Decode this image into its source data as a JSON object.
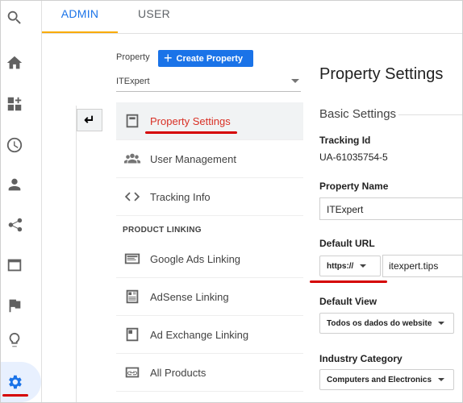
{
  "colors": {
    "accent": "#1a73e8",
    "highlight": "#d93025",
    "annotation": "#d50000",
    "tab_indicator": "#f9ab00"
  },
  "rail": {
    "icons": [
      "search-icon",
      "home-icon",
      "customization-icon",
      "clock-icon",
      "person-icon",
      "acquisition-icon",
      "behavior-icon",
      "flag-icon",
      "lightbulb-icon",
      "gear-icon"
    ]
  },
  "tabs": [
    {
      "label": "ADMIN"
    },
    {
      "label": "USER"
    }
  ],
  "property": {
    "label": "Property",
    "create_button": "Create Property",
    "selected": "ITExpert"
  },
  "nav": {
    "items": [
      {
        "label": "Property Settings",
        "icon": "page-icon"
      },
      {
        "label": "User Management",
        "icon": "people-icon"
      },
      {
        "label": "Tracking Info",
        "icon": "code-icon"
      }
    ],
    "section": "PRODUCT LINKING",
    "linking": [
      {
        "label": "Google Ads Linking",
        "icon": "ads-icon"
      },
      {
        "label": "AdSense Linking",
        "icon": "adsense-icon"
      },
      {
        "label": "Ad Exchange Linking",
        "icon": "adexchange-icon"
      },
      {
        "label": "All Products",
        "icon": "link-icon"
      }
    ]
  },
  "panel": {
    "title": "Property Settings",
    "subtitle": "Basic Settings",
    "tracking_id_label": "Tracking Id",
    "tracking_id": "UA-61035754-5",
    "property_name_label": "Property Name",
    "property_name": "ITExpert",
    "default_url_label": "Default URL",
    "protocol": "https://",
    "url": "itexpert.tips",
    "default_view_label": "Default View",
    "default_view": "Todos os dados do website",
    "industry_label": "Industry Category",
    "industry": "Computers and Electronics"
  }
}
